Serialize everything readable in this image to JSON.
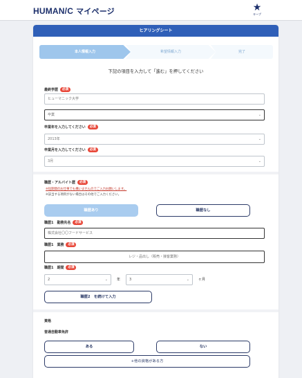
{
  "header": {
    "logo_text": "HUMAN/C",
    "logo_suffix": " マイページ",
    "star_label": "キープ"
  },
  "card": {
    "title": "ヒアリングシート"
  },
  "steps": [
    "本人情報入力",
    "希望情報入力",
    "完了"
  ],
  "instruction": "下記の項目を入力して「進む」を押してください",
  "required_badge": "必須",
  "education": {
    "label": "最終学歴",
    "school_value": "ヒューマニック大学",
    "status_value": "卒業",
    "year_label": "卒業年を入力してください",
    "year_value": "2013年",
    "month_label": "卒業月を入力してください",
    "month_value": "3月"
  },
  "career": {
    "label": "職歴・アルバイト歴",
    "note1": "※短期間のお仕事でも構いませんのでご入力お願いします。",
    "note2": "※該当する項目がない場合はその他でご入力ください。",
    "has_history": "職歴あり",
    "no_history": "職歴なし",
    "company_label": "職歴1　勤務先名",
    "company_value": "株式会社〇〇フードサービス",
    "job_label": "職歴1　業務",
    "job_value": "レジ・品出し（販売・接客業務）",
    "period_label": "職歴1　期間",
    "years_value": "2",
    "years_unit": "年",
    "months_value": "3",
    "months_unit": "ヶ月",
    "add_button": "職歴2　を続けて入力"
  },
  "qualifications": {
    "section_title": "資格",
    "license_label": "普通自動車免許",
    "yes": "ある",
    "no": "ない",
    "other_button": "+他の資格がある方"
  }
}
